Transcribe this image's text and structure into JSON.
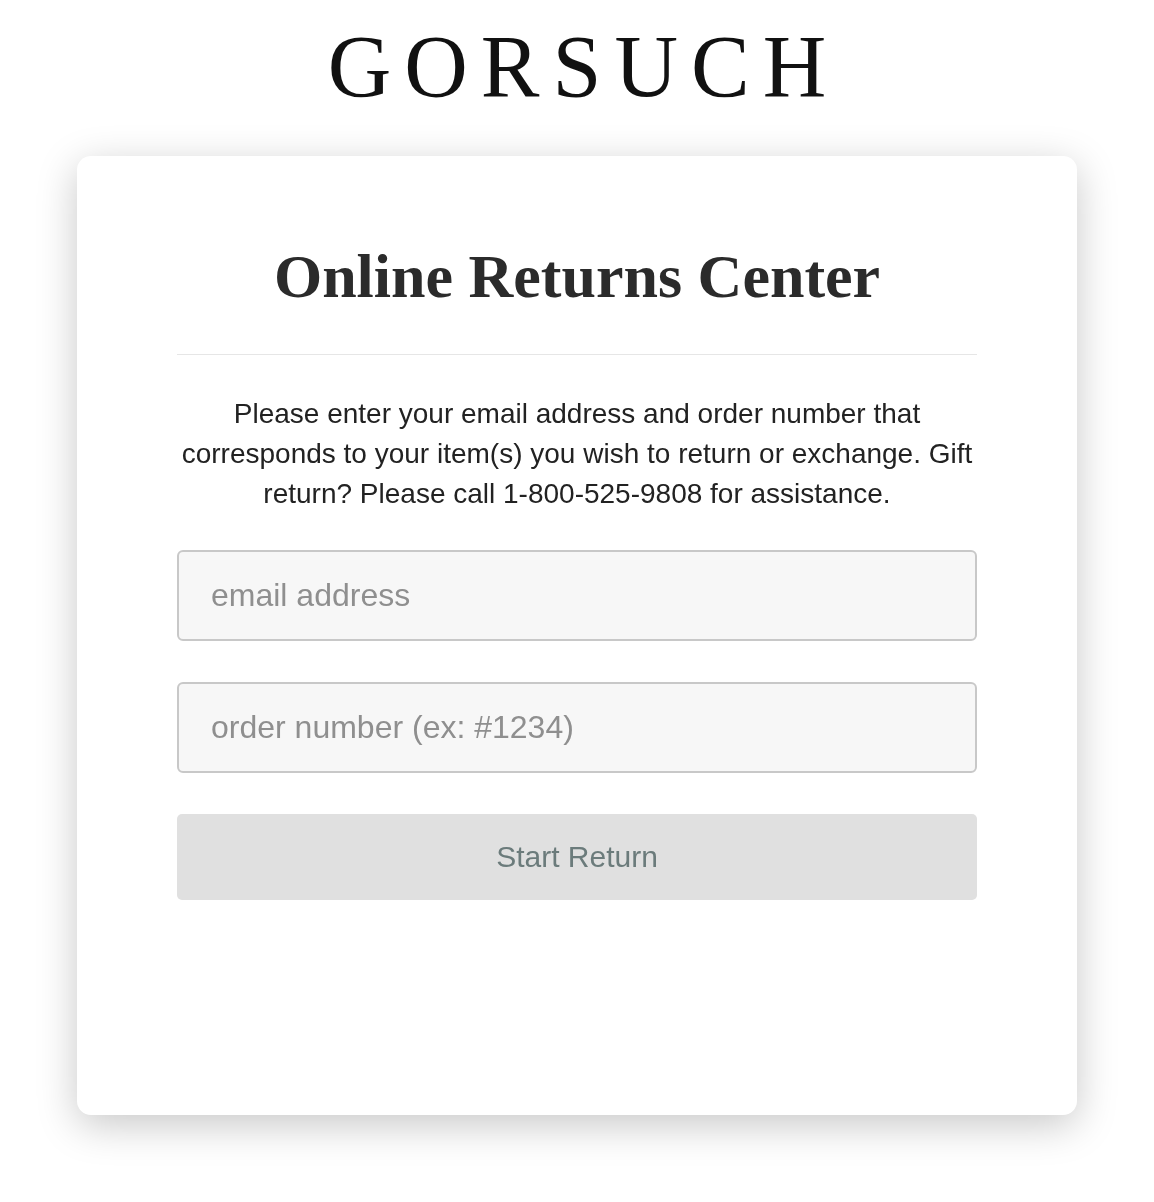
{
  "logo": "GORSUCH",
  "card": {
    "title": "Online Returns Center",
    "instructions": "Please enter your email address and order number that corresponds to your item(s) you wish to return or exchange. Gift return? Please call 1-800-525-9808 for assistance.",
    "fields": [
      {
        "placeholder": "email address"
      },
      {
        "placeholder": "order number (ex: #1234)"
      }
    ],
    "button": {
      "label": "Start Return",
      "disabled": true
    }
  }
}
